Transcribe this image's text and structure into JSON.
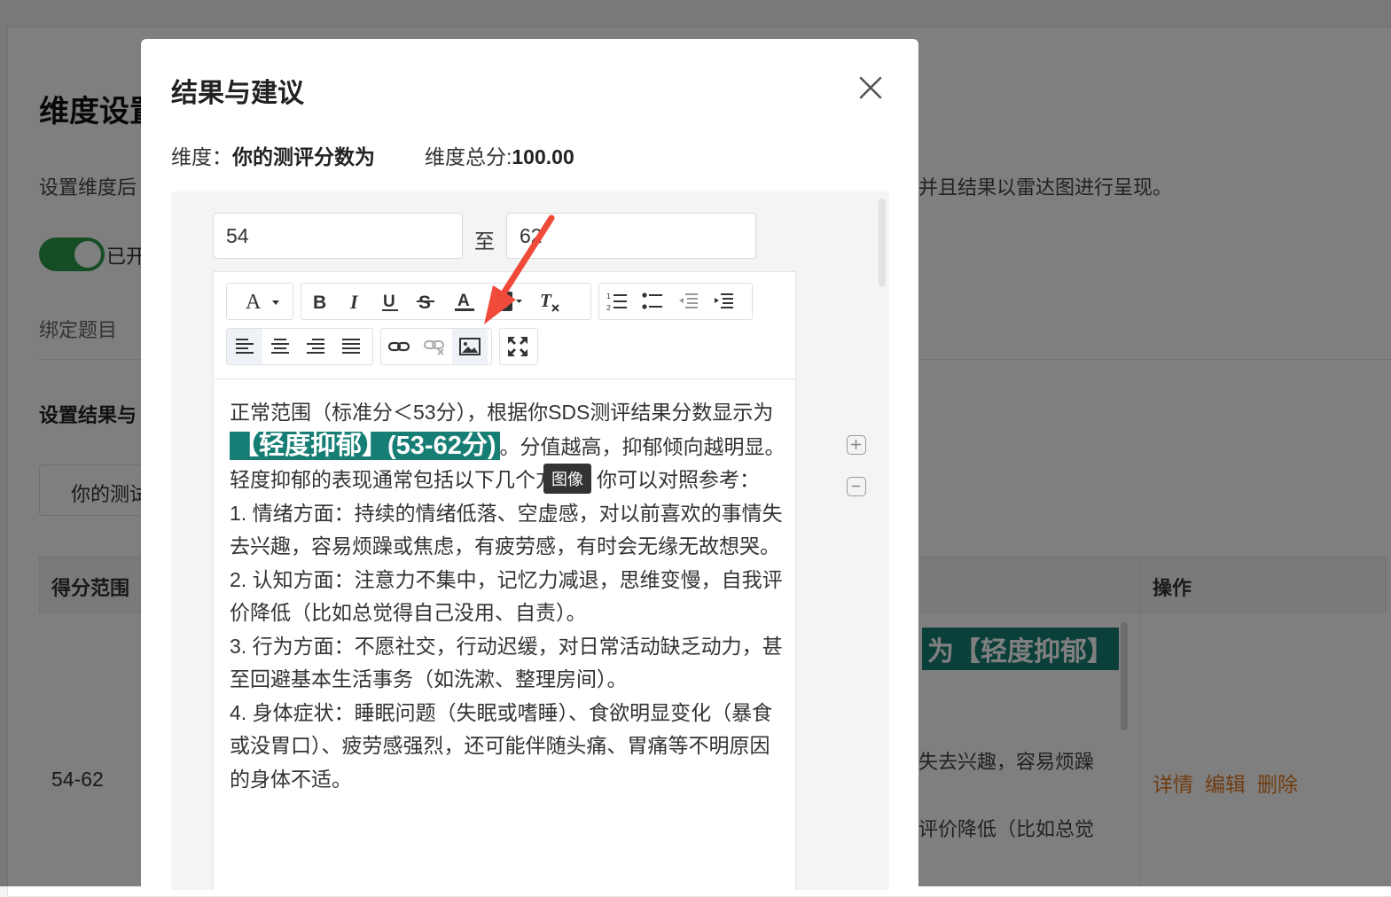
{
  "background": {
    "title": "维度设置",
    "description_left": "设置维度后",
    "description_right": "并且结果以雷达图进行呈现。",
    "toggle_label": "已开",
    "bind_label": "绑定题目",
    "section_title": "设置结果与",
    "select_value": "你的测试",
    "table": {
      "col_range": "得分范围",
      "col_ops": "操作",
      "row_range": "54-62",
      "highlight": "为【轻度抑郁】",
      "snippet_1": "失去兴趣，容易烦躁",
      "snippet_2": "评价降低（比如总觉",
      "op_detail": "详情",
      "op_edit": "编辑",
      "op_delete": "删除"
    }
  },
  "modal": {
    "title": "结果与建议",
    "dimension_label": "维度：",
    "dimension_name": "你的测评分数为",
    "total_label": "维度总分:",
    "total_value": "100.00",
    "range_from": "54",
    "range_separator": "至",
    "range_to": "62",
    "tooltip": "图像",
    "content": {
      "p1_before": "正常范围（标准分＜53分），根据你SDS测评结果分数显示为",
      "p1_highlight": "【轻度抑郁】(53-62分)",
      "p1_after": "。分值越高，抑郁倾向越明显。",
      "p2": "轻度抑郁的表现通常包括以下几个方面，你可以对照参考：",
      "p3": "1. 情绪方面：持续的情绪低落、空虚感，对以前喜欢的事情失去兴趣，容易烦躁或焦虑，有疲劳感，有时会无缘无故想哭。",
      "p4": "2. 认知方面：注意力不集中，记忆力减退，思维变慢，自我评价降低（比如总觉得自己没用、自责）。",
      "p5": "3. 行为方面：不愿社交，行动迟缓，对日常活动缺乏动力，甚至回避基本生活事务（如洗漱、整理房间）。",
      "p6": "4. 身体症状：睡眠问题（失眠或嗜睡）、食欲明显变化（暴食或没胃口）、疲劳感强烈，还可能伴随头痛、胃痛等不明原因的身体不适。"
    },
    "toolbar_icons": [
      "font-size-icon",
      "bold-icon",
      "italic-icon",
      "underline-icon",
      "strikethrough-icon",
      "font-color-icon",
      "background-color-icon",
      "clear-format-icon",
      "ordered-list-icon",
      "unordered-list-icon",
      "outdent-icon",
      "indent-icon",
      "align-left-icon",
      "align-center-icon",
      "align-right-icon",
      "align-justify-icon",
      "link-icon",
      "unlink-icon",
      "image-icon",
      "fullscreen-icon"
    ],
    "colors": {
      "highlight": "#167e74",
      "accent_orange": "#e07b22",
      "toggle_green": "#2a9d4b",
      "arrow_red": "#f04a3a"
    }
  }
}
